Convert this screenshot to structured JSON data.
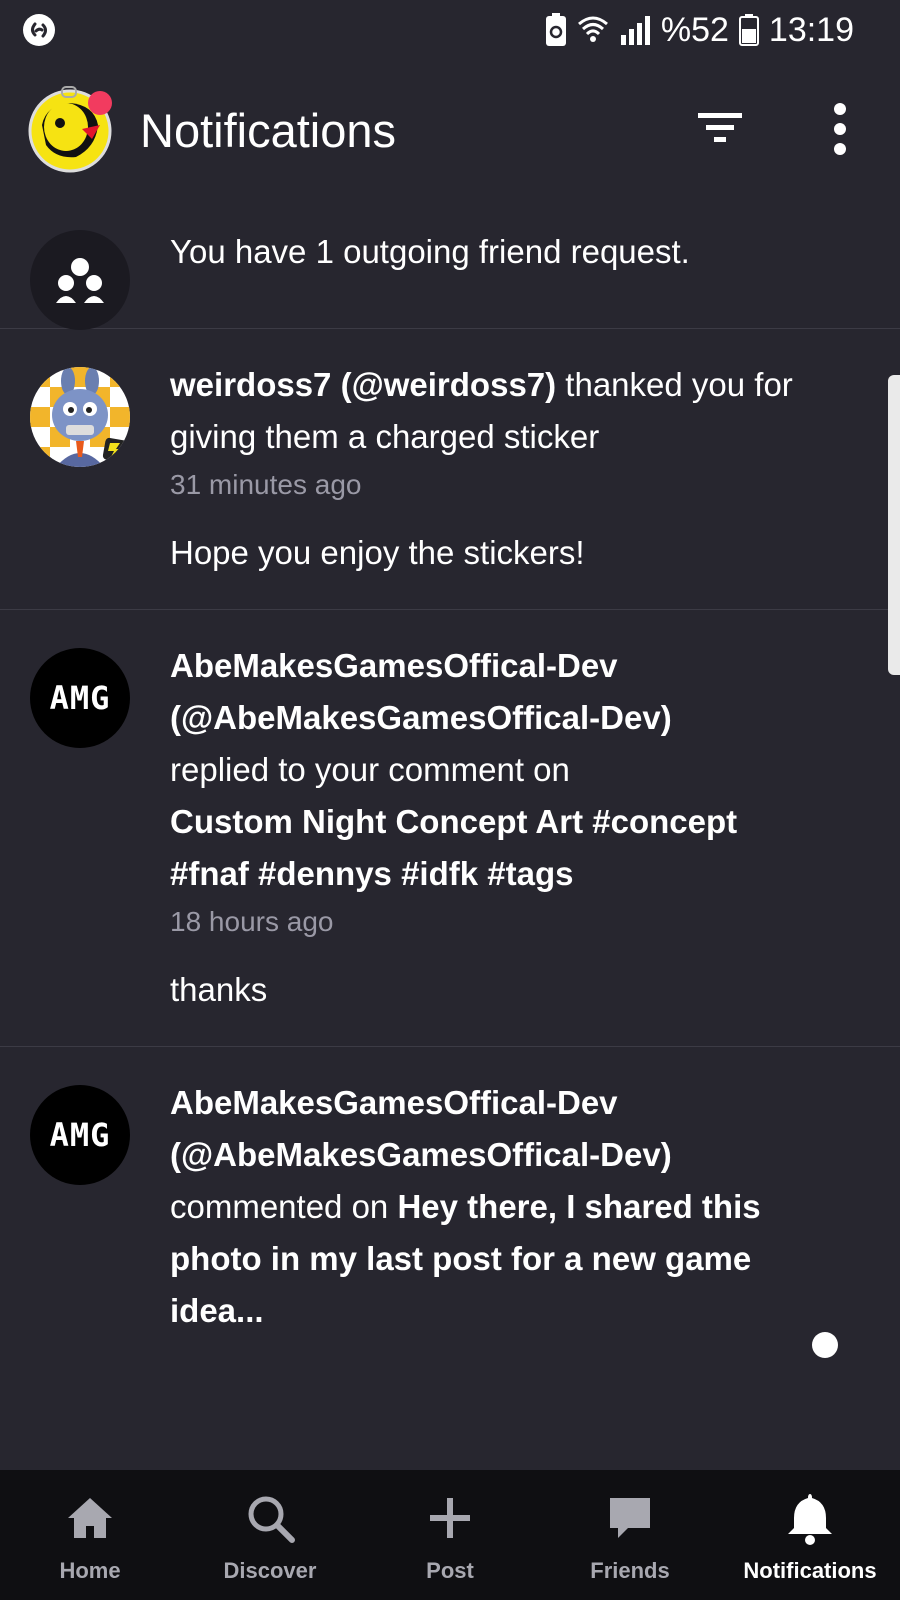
{
  "status_bar": {
    "left_icon": "shazam-icon",
    "battery_percent": "%52",
    "time": "13:19",
    "icons": [
      "battery-saver-icon",
      "wifi-icon",
      "signal-icon",
      "battery-icon"
    ]
  },
  "header": {
    "title": "Notifications",
    "filter_icon": "filter-icon",
    "more_icon": "more-vertical-icon"
  },
  "notifications": [
    {
      "type": "friend_request",
      "text": "You have 1 outgoing friend request."
    },
    {
      "user": "weirdoss7 (@weirdoss7)",
      "action": " thanked you for giving them a charged sticker",
      "time": "31 minutes ago",
      "message": "Hope you enjoy the stickers!"
    },
    {
      "user": "AbeMakesGamesOffical-Dev (@AbeMakesGamesOffical-Dev)",
      "action": " replied to your comment on ",
      "target": "Custom Night Concept Art #concept #fnaf #dennys #idfk #tags",
      "time": "18 hours ago",
      "message": "thanks",
      "avatar_text": "AMG"
    },
    {
      "user": "AbeMakesGamesOffical-Dev (@AbeMakesGamesOffical-Dev)",
      "action": "commented on ",
      "target": "Hey there, I shared this photo in my last post for a new game idea...",
      "avatar_text": "AMG",
      "unread": true
    }
  ],
  "bottom_nav": [
    {
      "label": "Home",
      "icon": "home-icon"
    },
    {
      "label": "Discover",
      "icon": "search-icon"
    },
    {
      "label": "Post",
      "icon": "plus-icon"
    },
    {
      "label": "Friends",
      "icon": "chat-icon"
    },
    {
      "label": "Notifications",
      "icon": "bell-icon",
      "active": true
    }
  ],
  "colors": {
    "background": "#27262f",
    "nav_background": "#0f0f12",
    "muted_text": "#9a99a6",
    "divider": "#3c3b45"
  }
}
